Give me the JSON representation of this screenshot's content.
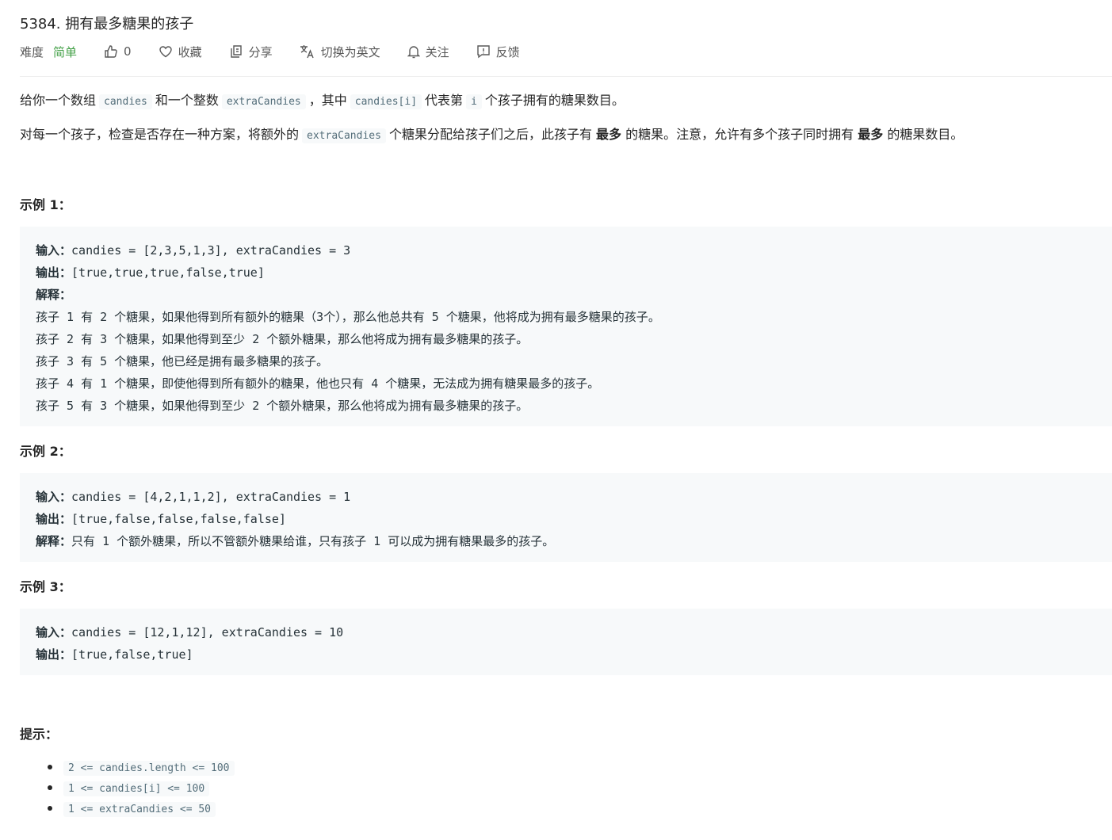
{
  "problem": {
    "title": "5384. 拥有最多糖果的孩子"
  },
  "toolbar": {
    "difficulty_label": "难度",
    "difficulty_value": "简单",
    "difficulty_color": "#43a047",
    "likes": "0",
    "favorite": "收藏",
    "share": "分享",
    "switch_lang": "切换为英文",
    "follow": "关注",
    "feedback": "反馈",
    "icons": [
      "thumbs-up-icon",
      "heart-icon",
      "share-icon",
      "translate-icon",
      "bell-icon",
      "feedback-icon"
    ]
  },
  "description": {
    "p1": {
      "t1": "给你一个数组",
      "c1": "candies",
      "t2": "和一个整数",
      "c2": "extraCandies",
      "t3": "，其中",
      "c3": "candies[i]",
      "t4": "代表第",
      "c4": "i",
      "t5": "个孩子拥有的糖果数目。"
    },
    "p2": {
      "t1": "对每一个孩子，检查是否存在一种方案，将额外的",
      "c1": "extraCandies",
      "t2": "个糖果分配给孩子们之后，此孩子有",
      "b1": "最多",
      "t3": "的糖果。注意，允许有多个孩子同时拥有",
      "b2": "最多",
      "t4": "的糖果数目。"
    }
  },
  "examples": [
    {
      "heading": "示例 1：",
      "input_label": "输入：",
      "input": "candies = [2,3,5,1,3], extraCandies = 3",
      "output_label": "输出：",
      "output": "[true,true,true,false,true]",
      "explain_label": "解释：",
      "explain_lines": [
        "孩子 1 有 2 个糖果，如果他得到所有额外的糖果（3个），那么他总共有 5 个糖果，他将成为拥有最多糖果的孩子。",
        "孩子 2 有 3 个糖果，如果他得到至少 2 个额外糖果，那么他将成为拥有最多糖果的孩子。",
        "孩子 3 有 5 个糖果，他已经是拥有最多糖果的孩子。",
        "孩子 4 有 1 个糖果，即使他得到所有额外的糖果，他也只有 4 个糖果，无法成为拥有糖果最多的孩子。",
        "孩子 5 有 3 个糖果，如果他得到至少 2 个额外糖果，那么他将成为拥有最多糖果的孩子。"
      ]
    },
    {
      "heading": "示例 2：",
      "input_label": "输入：",
      "input": "candies = [4,2,1,1,2], extraCandies = 1",
      "output_label": "输出：",
      "output": "[true,false,false,false,false]",
      "explain_label": "解释：",
      "explain": "只有 1 个额外糖果，所以不管额外糖果给谁，只有孩子 1 可以成为拥有糖果最多的孩子。"
    },
    {
      "heading": "示例 3：",
      "input_label": "输入：",
      "input": "candies = [12,1,12], extraCandies = 10",
      "output_label": "输出：",
      "output": "[true,false,true]"
    }
  ],
  "hints": {
    "heading": "提示：",
    "items": [
      "2 <= candies.length <= 100",
      "1 <= candies[i] <= 100",
      "1 <= extraCandies <= 50"
    ]
  }
}
